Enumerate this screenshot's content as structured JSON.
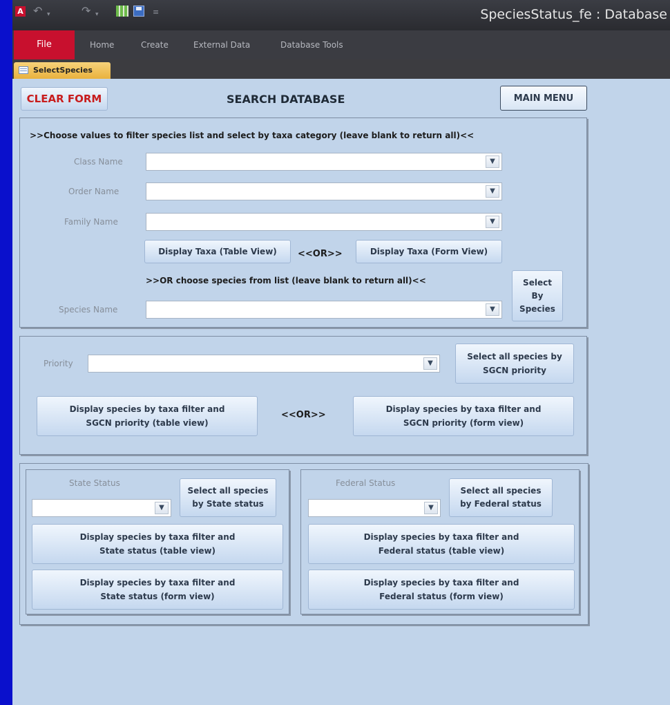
{
  "window": {
    "title": "SpeciesStatus_fe : Database"
  },
  "quick_access": {
    "icons": [
      "access-logo",
      "undo-icon",
      "redo-icon",
      "grid-icon",
      "save-icon",
      "customize-icon"
    ],
    "logo_letter": "A"
  },
  "ribbon": {
    "tabs": [
      "File",
      "Home",
      "Create",
      "External Data",
      "Database Tools"
    ]
  },
  "document_tab": {
    "label": "SelectSpecies"
  },
  "colors": {
    "file_tab": "#c8102e",
    "clear_form_text": "#c81d1d",
    "workspace": "#c1d4ea",
    "outer_background": "#0a10cc"
  },
  "form": {
    "clear_label": "CLEAR FORM",
    "heading": "SEARCH DATABASE",
    "main_menu_label": "MAIN MENU",
    "taxa": {
      "instruction": ">>Choose values to filter species list and select by taxa category (leave blank to return all)<<",
      "class_label": "Class Name",
      "order_label": "Order Name",
      "family_label": "Family Name",
      "table_view_label": "Display Taxa (Table View)",
      "or_label": "<<OR>>",
      "form_view_label": "Display Taxa (Form View)",
      "species_instruction": ">>OR choose species from list (leave blank to return all)<<",
      "species_label": "Species Name",
      "select_by_species": [
        "Select",
        "By",
        "Species"
      ]
    },
    "priority": {
      "label": "Priority",
      "select_all": [
        "Select all species by",
        "SGCN priority"
      ],
      "table_btn": [
        "Display species by taxa filter and",
        "SGCN priority (table view)"
      ],
      "or_label": "<<OR>>",
      "form_btn": [
        "Display species by taxa filter and",
        "SGCN priority (form view)"
      ]
    },
    "state": {
      "label": "State Status",
      "select_all": [
        "Select all species",
        "by State status"
      ],
      "table_btn": [
        "Display species by taxa filter and",
        "State status (table view)"
      ],
      "form_btn": [
        "Display species by taxa filter and",
        "State status (form view)"
      ]
    },
    "federal": {
      "label": "Federal Status",
      "select_all": [
        "Select all species",
        "by Federal status"
      ],
      "table_btn": [
        "Display species by taxa filter and",
        "Federal status (table view)"
      ],
      "form_btn": [
        "Display species by taxa filter and",
        "Federal status (form view)"
      ]
    }
  }
}
